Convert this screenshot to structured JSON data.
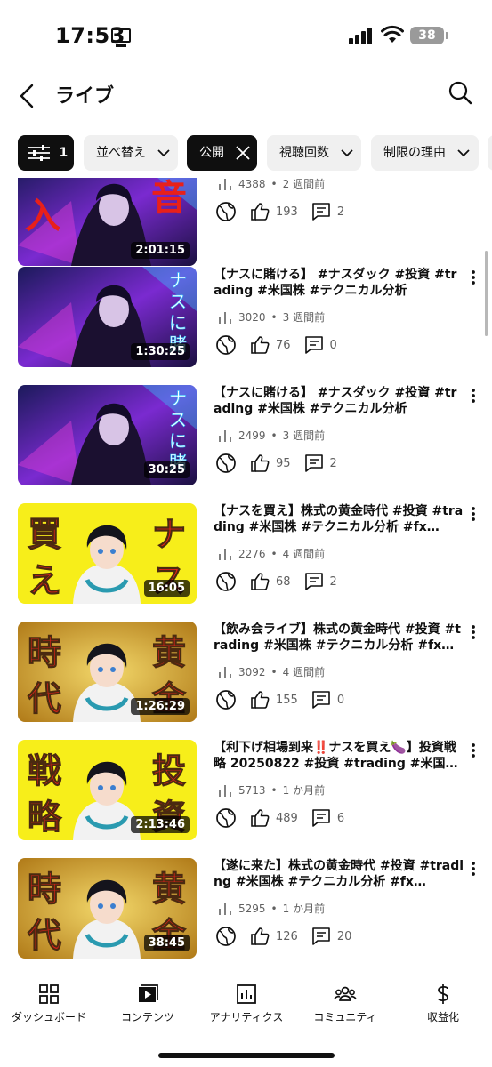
{
  "status_bar": {
    "time": "17:53",
    "battery": "38"
  },
  "header": {
    "title": "ライブ",
    "back_icon": "chevron-left-icon",
    "search_icon": "search-icon"
  },
  "filters": {
    "settings_count": "1",
    "sort_label": "並べ替え",
    "visibility_label": "公開",
    "views_label": "視聴回数",
    "restrictions_label": "制限の理由"
  },
  "videos": [
    {
      "title": "",
      "views": "4388",
      "age": "2 週間前",
      "duration": "2:01:15",
      "likes": "193",
      "comments": "2",
      "thumb_chars": [
        "入",
        "音"
      ],
      "thumb_style": "neon-red"
    },
    {
      "title": "【ナスに賭ける】 #ナスダック #投資 #trading #米国株 #テクニカル分析",
      "views": "3020",
      "age": "3 週間前",
      "duration": "1:30:25",
      "likes": "76",
      "comments": "0",
      "thumb_chars": [
        "ナスに賭"
      ],
      "thumb_style": "neon"
    },
    {
      "title": "【ナスに賭ける】 #ナスダック #投資 #trading #米国株 #テクニカル分析",
      "views": "2499",
      "age": "3 週間前",
      "duration": "30:25",
      "likes": "95",
      "comments": "2",
      "thumb_chars": [
        "ナスに賭"
      ],
      "thumb_style": "neon"
    },
    {
      "title": "【ナスを買え】株式の黄金時代 #投資 #trading #米国株 #テクニカル分析 #fx…",
      "views": "2276",
      "age": "4 週間前",
      "duration": "16:05",
      "likes": "68",
      "comments": "2",
      "thumb_chars": [
        "買",
        "え",
        "ナ",
        "ス"
      ],
      "thumb_style": "yellow"
    },
    {
      "title": "【飲み会ライブ】株式の黄金時代 #投資 #trading #米国株 #テクニカル分析 #fx…",
      "views": "3092",
      "age": "4 週間前",
      "duration": "1:26:29",
      "likes": "155",
      "comments": "0",
      "thumb_chars": [
        "時",
        "代",
        "黄",
        "金"
      ],
      "thumb_style": "gold"
    },
    {
      "title": "【利下げ相場到来‼️ナスを買え🍆】投資戦略 20250822 #投資 #trading #米国…",
      "views": "5713",
      "age": "1 か月前",
      "duration": "2:13:46",
      "likes": "489",
      "comments": "6",
      "thumb_chars": [
        "戦",
        "略",
        "投",
        "資"
      ],
      "thumb_style": "yellow"
    },
    {
      "title": "【遂に来た】株式の黄金時代 #投資 #trading #米国株 #テクニカル分析 #fx…",
      "views": "5295",
      "age": "1 か月前",
      "duration": "38:45",
      "likes": "126",
      "comments": "20",
      "thumb_chars": [
        "時",
        "代",
        "黄",
        "金"
      ],
      "thumb_style": "gold"
    }
  ],
  "bottom_nav": {
    "dashboard": "ダッシュボード",
    "content": "コンテンツ",
    "analytics": "アナリティクス",
    "community": "コミュニティ",
    "monetization": "収益化"
  },
  "colors": {
    "text": "#0f0f0f",
    "secondary": "#606060",
    "chip_bg": "#f0f0f0",
    "thumb_red": "#e8201a",
    "thumb_yellow": "#f7ee1a"
  }
}
